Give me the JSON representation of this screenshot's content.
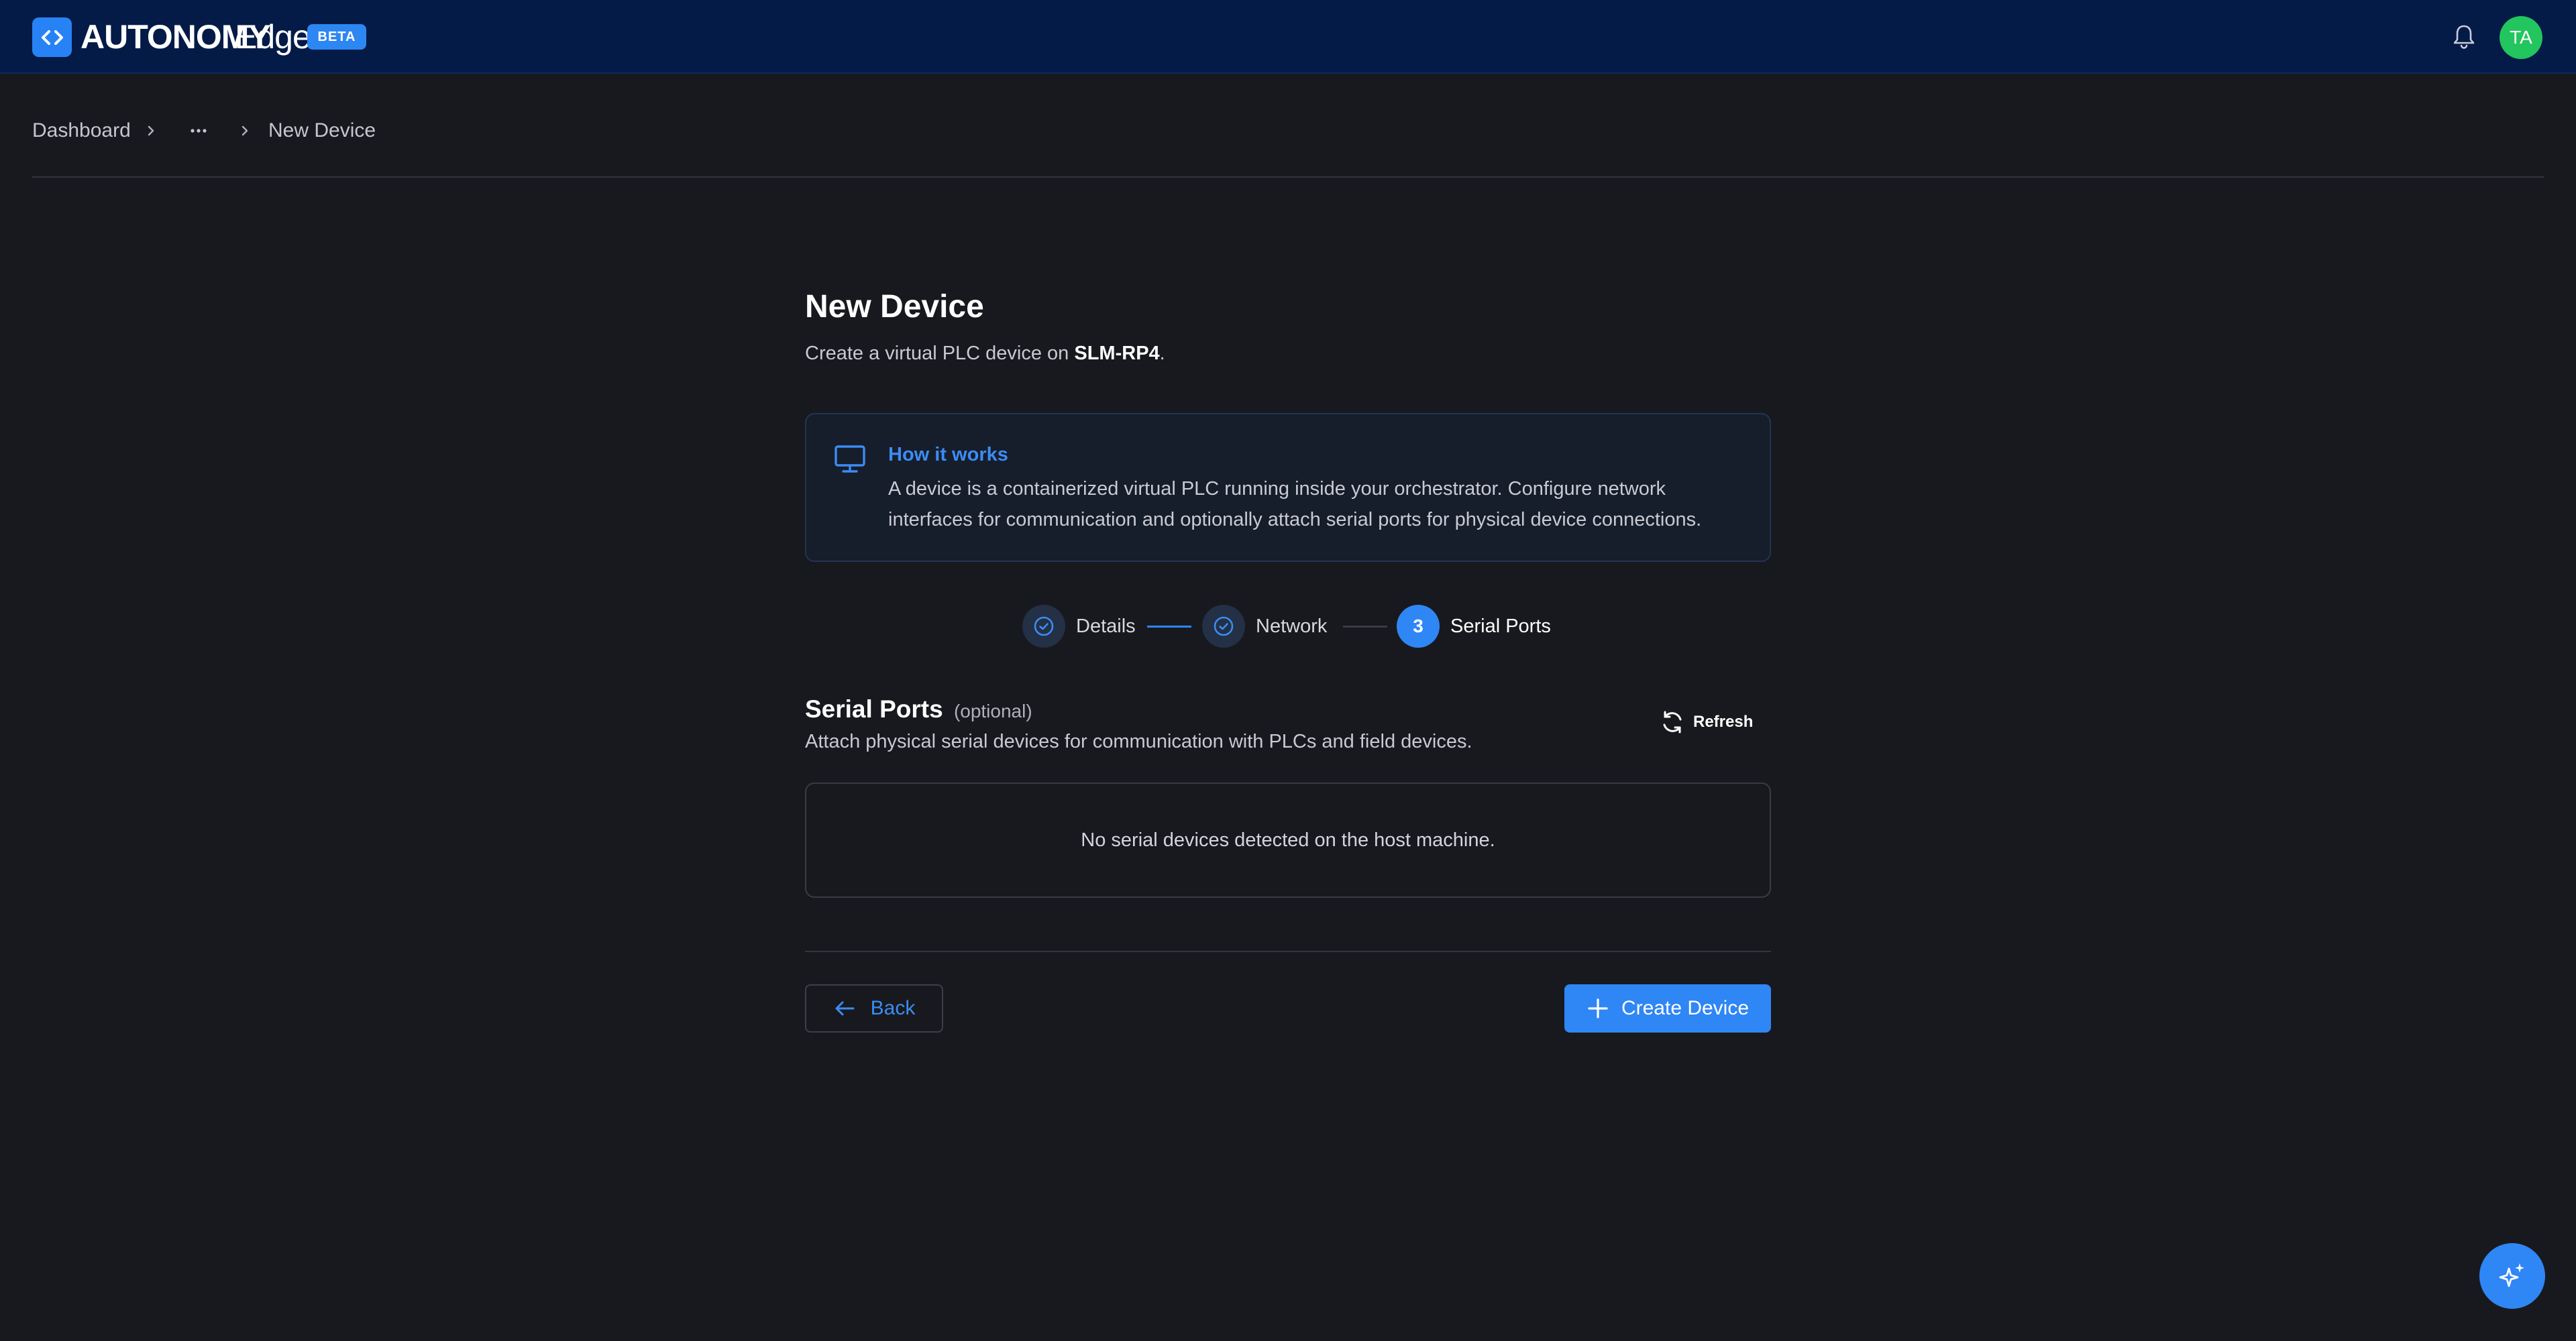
{
  "app": {
    "brand_main": "AUTONOMY",
    "brand_secondary": "Edge",
    "badge": "BETA",
    "user_initials": "TA",
    "colors": {
      "topbar": "#041b47",
      "accent": "#2f86f5",
      "avatar": "#22c55e",
      "background": "#18191e"
    }
  },
  "breadcrumb": {
    "items": [
      "Dashboard",
      "...",
      "New Device"
    ]
  },
  "page": {
    "title": "New Device",
    "subtitle_prefix": "Create a virtual PLC device on ",
    "subtitle_host": "SLM-RP4",
    "subtitle_suffix": "."
  },
  "info": {
    "icon": "monitor-icon",
    "title": "How it works",
    "text": "A device is a containerized virtual PLC running inside your orchestrator. Configure network interfaces for communication and optionally attach serial ports for physical device connections."
  },
  "stepper": {
    "steps": [
      {
        "label": "Details",
        "state": "complete"
      },
      {
        "label": "Network",
        "state": "complete"
      },
      {
        "label": "Serial Ports",
        "state": "active",
        "number": "3"
      }
    ]
  },
  "serial": {
    "title": "Serial Ports",
    "optional": "(optional)",
    "description": "Attach physical serial devices for communication with PLCs and field devices.",
    "refresh_label": "Refresh",
    "empty_message": "No serial devices detected on the host machine."
  },
  "actions": {
    "back_label": "Back",
    "create_label": "Create Device"
  },
  "fab": {
    "icon": "sparkles-icon"
  }
}
